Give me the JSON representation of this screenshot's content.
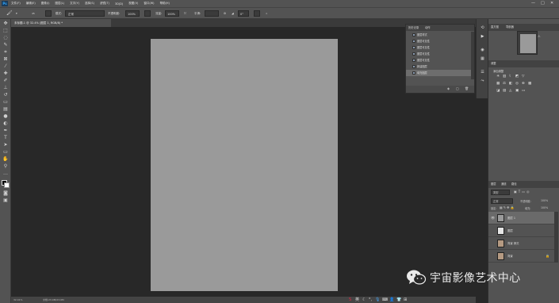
{
  "app": {
    "logo": "Ps"
  },
  "menu": [
    "文件(F)",
    "编辑(E)",
    "图像(I)",
    "图层(L)",
    "文字(Y)",
    "选择(S)",
    "滤镜(T)",
    "3D(D)",
    "视图(V)",
    "窗口(W)",
    "帮助(H)"
  ],
  "window_controls": [
    "—",
    "□",
    "✕"
  ],
  "options": {
    "size": "45",
    "mode_label": "模式:",
    "mode_value": "正常",
    "opacity_label": "不透明度:",
    "opacity_value": "100%",
    "flow_label": "流量:",
    "flow_value": "100%",
    "smooth_label": "平滑:",
    "angle_value": "0°"
  },
  "document_tab": "未标题-1 @ 32.4% (图层 1, RGB/8) *",
  "status": {
    "zoom": "32.41%",
    "doc_size": "文档:23.9M/23.9M"
  },
  "history_panel": {
    "tabs": [
      "历史记录",
      "动作"
    ],
    "items": [
      "图层样式",
      "图层可见性",
      "图层可见性",
      "图层可见性",
      "图层可见性",
      "新建图层",
      "填充图层"
    ],
    "selected_index": 6,
    "footer_icons": [
      "snapshot-icon",
      "new-doc-icon",
      "trash-icon"
    ]
  },
  "right_panels": {
    "top_tabs": [
      "直方图",
      "导航器"
    ],
    "adjust_title": "调整",
    "adjust_subtitle": "添加调整",
    "layers_tabs": [
      "图层",
      "通道",
      "路径"
    ],
    "layer_search": "类型",
    "blend_mode": "正常",
    "opacity_label": "不透明度:",
    "opacity_value": "100%",
    "lock_label": "锁定:",
    "fill_label": "填充:",
    "fill_value": "100%",
    "layers": [
      {
        "name": "图层 1",
        "selected": true,
        "thumb": "gray"
      },
      {
        "name": "图层",
        "selected": false,
        "thumb": "white"
      },
      {
        "name": "背景 拷贝",
        "selected": false,
        "thumb": "photo"
      },
      {
        "name": "背景",
        "selected": false,
        "thumb": "photo"
      }
    ]
  },
  "watermark": "宇宙影像艺术中心",
  "colors": {
    "panel": "#535353",
    "canvas_bg": "#282828",
    "document": "#9a9a9a",
    "accent": "#31a8ff"
  }
}
